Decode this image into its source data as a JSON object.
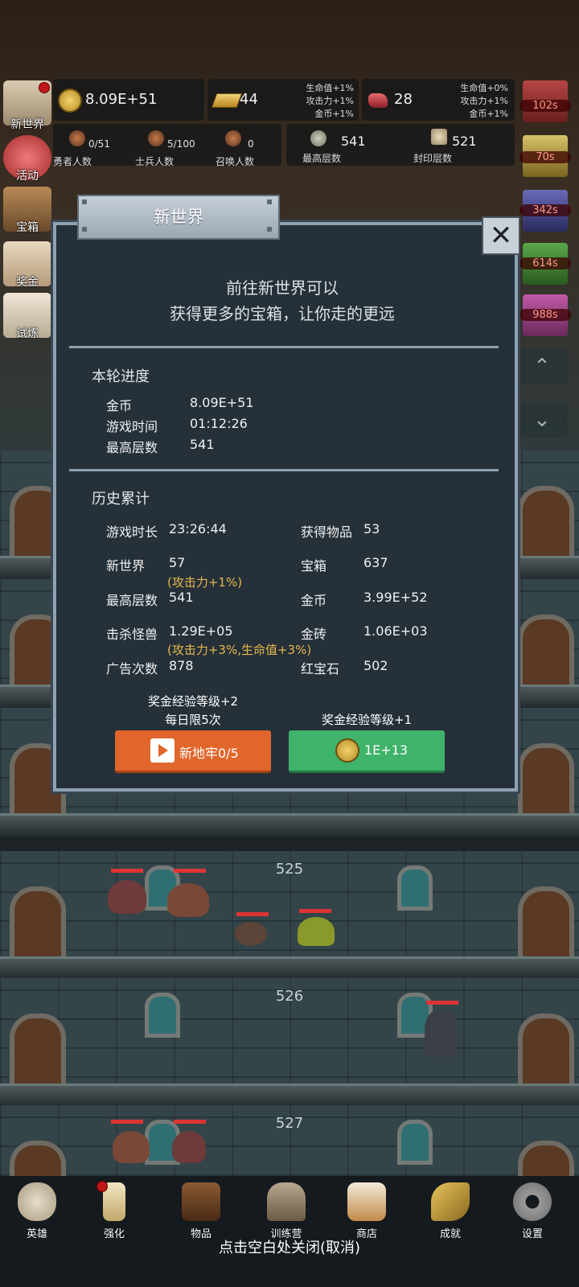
{
  "hud": {
    "gold": "8.09E+51",
    "gold_bar": "44",
    "ruby": "28",
    "gold_bar_bonus": [
      "生命值+1%",
      "攻击力+1%",
      "金币+1%"
    ],
    "ruby_bonus": [
      "生命值+0%",
      "攻击力+1%",
      "金币+1%"
    ],
    "heroes_val": "0/51",
    "heroes_lbl": "勇者人数",
    "soldiers_val": "5/100",
    "soldiers_lbl": "士兵人数",
    "summon_val": "0",
    "summon_lbl": "召唤人数",
    "max_floor_val": "541",
    "max_floor_lbl": "最高层数",
    "sealed_val": "521",
    "sealed_lbl": "封印层数"
  },
  "left_menu": [
    "新世界",
    "活动",
    "宝箱",
    "奖金",
    "试炼"
  ],
  "right_timers": [
    "102s",
    "70s",
    "342s",
    "614s",
    "988s"
  ],
  "modal": {
    "title": "新世界",
    "desc_line1": "前往新世界可以",
    "desc_line2": "获得更多的宝箱，让你走的更远",
    "current_title": "本轮进度",
    "current": {
      "gold_k": "金币",
      "gold_v": "8.09E+51",
      "time_k": "游戏时间",
      "time_v": "01:12:26",
      "floor_k": "最高层数",
      "floor_v": "541"
    },
    "history_title": "历史累计",
    "history": {
      "playtime_k": "游戏时长",
      "playtime_v": "23:26:44",
      "items_k": "获得物品",
      "items_v": "53",
      "newworld_k": "新世界",
      "newworld_v": "57",
      "newworld_note": "(攻击力+1%)",
      "chest_k": "宝箱",
      "chest_v": "637",
      "maxfloor_k": "最高层数",
      "maxfloor_v": "541",
      "gold_k": "金币",
      "gold_v": "3.99E+52",
      "kills_k": "击杀怪兽",
      "kills_v": "1.29E+05",
      "kills_note": "(攻击力+3%,生命值+3%)",
      "goldbar_k": "金砖",
      "goldbar_v": "1.06E+03",
      "ads_k": "广告次数",
      "ads_v": "878",
      "ruby_k": "红宝石",
      "ruby_v": "502"
    },
    "bonus_left_1": "奖金经验等级+2",
    "bonus_left_2": "每日限5次",
    "bonus_right": "奖金经验等级+1",
    "btn_video": "新地牢0/5",
    "btn_coin": "1E+13"
  },
  "floors": [
    "525",
    "526",
    "527"
  ],
  "nav": [
    "英雄",
    "强化",
    "物品",
    "训练营",
    "商店",
    "成就",
    "设置"
  ],
  "hint": "点击空白处关闭(取消)"
}
